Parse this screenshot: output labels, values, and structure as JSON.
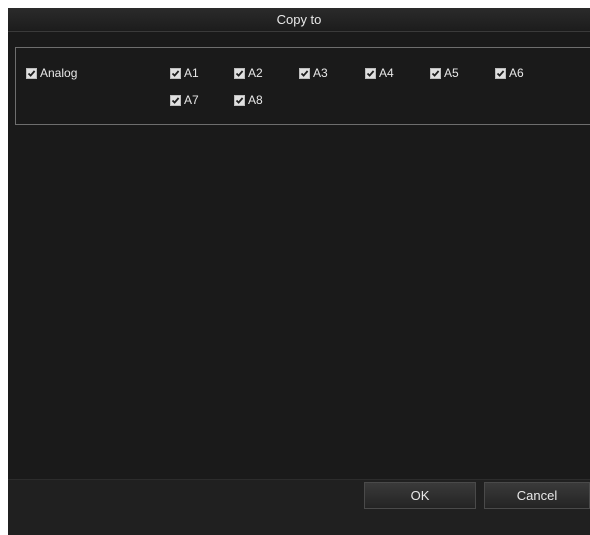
{
  "dialog": {
    "title": "Copy to"
  },
  "group": {
    "label": "Analog",
    "checked": true,
    "channels": [
      {
        "label": "A1",
        "checked": true
      },
      {
        "label": "A2",
        "checked": true
      },
      {
        "label": "A3",
        "checked": true
      },
      {
        "label": "A4",
        "checked": true
      },
      {
        "label": "A5",
        "checked": true
      },
      {
        "label": "A6",
        "checked": true
      },
      {
        "label": "A7",
        "checked": true
      },
      {
        "label": "A8",
        "checked": true
      }
    ]
  },
  "buttons": {
    "ok": "OK",
    "cancel": "Cancel"
  },
  "colors": {
    "background": "#1a1a1a",
    "text": "#e8e8e8",
    "checkbox": "#e0e0e0",
    "group_border": "#6e6e6e"
  }
}
